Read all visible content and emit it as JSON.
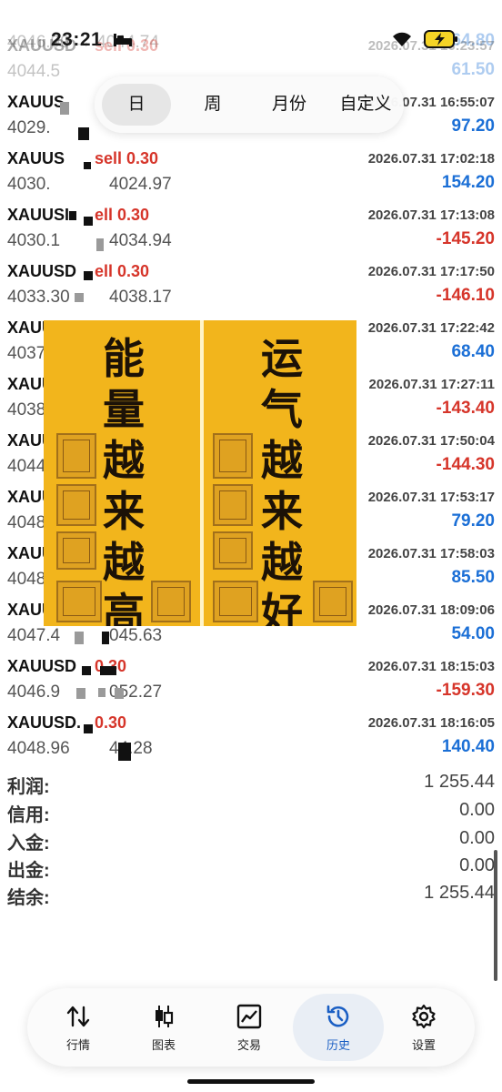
{
  "status_bar": {
    "time": "23:21"
  },
  "period_tabs": [
    {
      "label": "日",
      "active": true
    },
    {
      "label": "周",
      "active": false
    },
    {
      "label": "月份",
      "active": false
    },
    {
      "label": "自定义",
      "active": false
    }
  ],
  "trades": [
    {
      "symbol": "",
      "side": "",
      "time": "",
      "prices": "4046.90 → 4044.74",
      "profit": "64.80",
      "faded": true
    },
    {
      "symbol": "XAUUSD",
      "side": "sell 0.30",
      "time": "2026.07.31 16:23:57",
      "prices": "4044.5",
      "profit": "61.50",
      "faded": true
    },
    {
      "symbol": "XAUUS",
      "side": "",
      "time": "2026.07.31 16:55:07",
      "prices": "4029.",
      "profit": "97.20",
      "faded": false
    },
    {
      "symbol": "XAUUS",
      "side": "sell 0.30",
      "time": "2026.07.31 17:02:18",
      "prices": "4030.",
      "close": "4024.97",
      "profit": "154.20",
      "faded": false
    },
    {
      "symbol": "XAUUSI",
      "side": "ell 0.30",
      "time": "2026.07.31 17:13:08",
      "prices": "4030.1",
      "close": "4034.94",
      "profit": "-145.20",
      "faded": false
    },
    {
      "symbol": "XAUUSD",
      "side": "ell 0.30",
      "time": "2026.07.31 17:17:50",
      "prices": "4033.30",
      "close": "4038.17",
      "profit": "-146.10",
      "faded": false
    },
    {
      "symbol": "XAUUSD",
      "side": "",
      "time": "2026.07.31 17:22:42",
      "prices": "4037",
      "profit": "68.40",
      "faded": false
    },
    {
      "symbol": "XAUU",
      "side": "",
      "time": "2026.07.31 17:27:11",
      "prices": "4038",
      "profit": "-143.40",
      "faded": false
    },
    {
      "symbol": "XAUU",
      "side": "",
      "time": "2026.07.31 17:50:04",
      "prices": "4044",
      "profit": "-144.30",
      "faded": false
    },
    {
      "symbol": "XAUU",
      "side": "",
      "time": "2026.07.31 17:53:17",
      "prices": "4048",
      "profit": "79.20",
      "faded": false
    },
    {
      "symbol": "XAUU",
      "side": "",
      "time": "2026.07.31 17:58:03",
      "prices": "4048",
      "profit": "85.50",
      "faded": false
    },
    {
      "symbol": "XAUU",
      "side": "",
      "time": "2026.07.31 18:09:06",
      "prices": "4047.4",
      "close": "045.63",
      "profit": "54.00",
      "faded": false
    },
    {
      "symbol": "XAUUSD",
      "side": "0.30",
      "time": "2026.07.31 18:15:03",
      "prices": "4046.9",
      "close": "052.27",
      "profit": "-159.30",
      "faded": false
    },
    {
      "symbol": "XAUUSD.",
      "side": "0.30",
      "time": "2026.07.31 18:16:05",
      "prices": "4048.96",
      "close": "44.28",
      "profit": "140.40",
      "faded": false
    }
  ],
  "poster": {
    "left_text": "能量越来越高",
    "right_text": "运气越来越好"
  },
  "summary": [
    {
      "label": "利润:",
      "value": "1 255.44"
    },
    {
      "label": "信用:",
      "value": "0.00"
    },
    {
      "label": "入金:",
      "value": "0.00"
    },
    {
      "label": "出金:",
      "value": "0.00"
    },
    {
      "label": "结余:",
      "value": "1 255.44"
    }
  ],
  "nav": [
    {
      "label": "行情",
      "icon": "quotes-icon",
      "active": false
    },
    {
      "label": "图表",
      "icon": "candlestick-icon",
      "active": false
    },
    {
      "label": "交易",
      "icon": "trade-chart-icon",
      "active": false
    },
    {
      "label": "历史",
      "icon": "history-icon",
      "active": true
    },
    {
      "label": "设置",
      "icon": "gear-icon",
      "active": false
    }
  ],
  "colors": {
    "profit": "#1b6fd6",
    "loss": "#d6352a",
    "poster": "#f2b51c",
    "nav_active": "#1b5fc4"
  }
}
